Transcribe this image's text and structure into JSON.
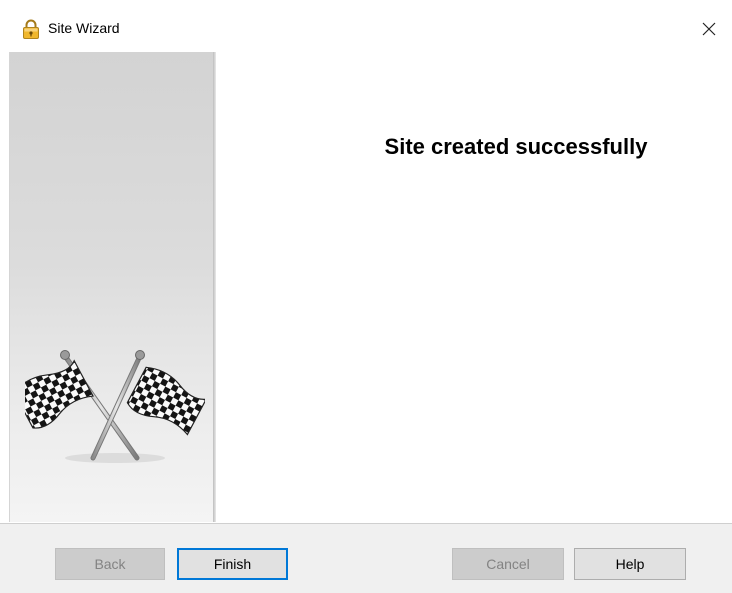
{
  "window": {
    "title": "Site Wizard",
    "icon": "lock-icon",
    "close_icon": "close-icon"
  },
  "side_panel": {
    "image": "checkered-flags-icon"
  },
  "main": {
    "heading": "Site created successfully"
  },
  "buttons": {
    "back": "Back",
    "finish": "Finish",
    "cancel": "Cancel",
    "help": "Help"
  },
  "colors": {
    "focus_border": "#0078d7",
    "button_face": "#e1e1e1",
    "disabled_face": "#cccccc"
  }
}
